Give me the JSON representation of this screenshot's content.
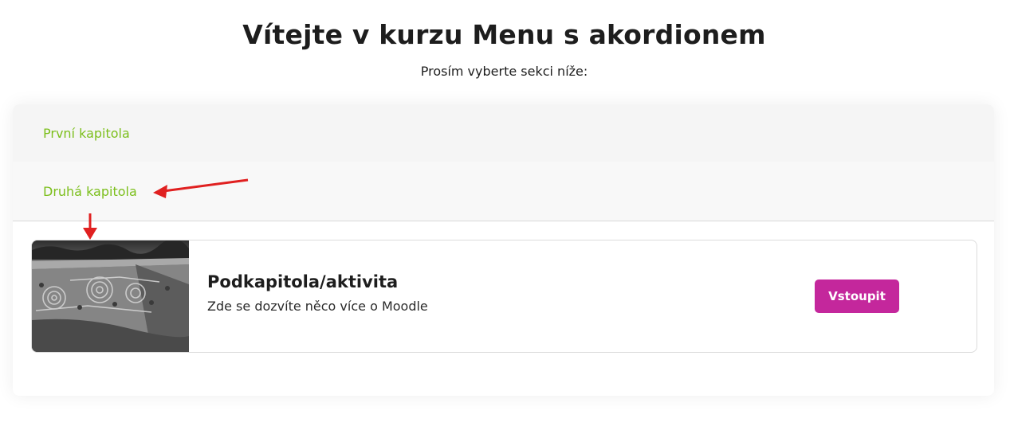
{
  "page": {
    "title": "Vítejte v kurzu Menu s akordionem",
    "subtitle": "Prosím vyberte sekci níže:"
  },
  "accordion": {
    "sections": [
      {
        "label": "První kapitola",
        "expanded": false
      },
      {
        "label": "Druhá kapitola",
        "expanded": true
      }
    ],
    "activity": {
      "title": "Podkapitola/aktivita",
      "description": "Zde se dozvíte něco více o Moodle",
      "button_label": "Vstoupit",
      "thumbnail": "aerial-photo-garden-labyrinth"
    }
  },
  "colors": {
    "section_link": "#7cbf1c",
    "button": "#c4279c",
    "annotation_arrow": "#e02020"
  },
  "annotations": [
    "arrow-icon",
    "arrow-icon"
  ]
}
